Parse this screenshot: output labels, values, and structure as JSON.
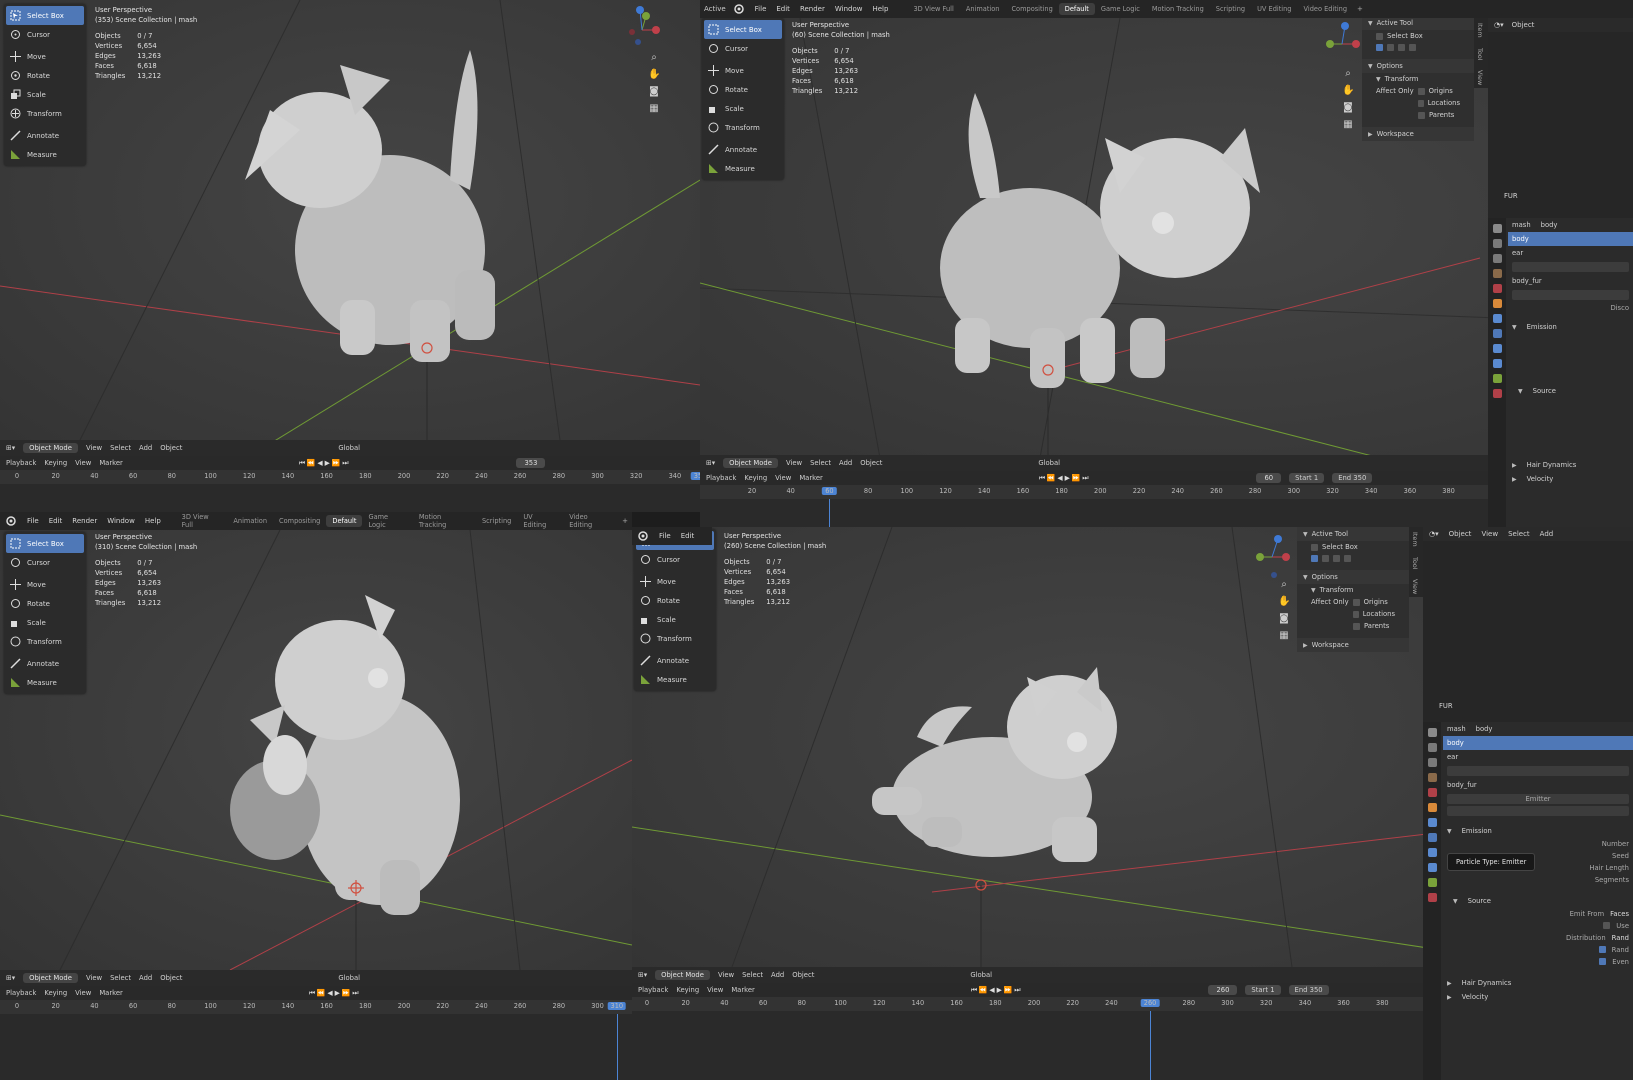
{
  "stats": {
    "perspective": "User Perspective",
    "objects_label": "Objects",
    "objects": "0 / 7",
    "vertices_label": "Vertices",
    "vertices": "6,654",
    "edges_label": "Edges",
    "edges": "13,263",
    "faces_label": "Faces",
    "faces": "6,618",
    "triangles_label": "Triangles",
    "triangles": "13,212"
  },
  "panes": [
    {
      "collection": "(353) Scene Collection | mash",
      "frame": "353"
    },
    {
      "collection": "(60) Scene Collection | mash",
      "frame": "60"
    },
    {
      "collection": "(310) Scene Collection | mash",
      "frame": "310"
    },
    {
      "collection": "(260) Scene Collection | mash",
      "frame": "260"
    }
  ],
  "tools": [
    "Select Box",
    "Cursor",
    "Move",
    "Rotate",
    "Scale",
    "Transform",
    "Annotate",
    "Measure"
  ],
  "topmenu": [
    "File",
    "Edit",
    "Render",
    "Window",
    "Help"
  ],
  "workspaces": [
    "3D View Full",
    "Animation",
    "Compositing",
    "Default",
    "Game Logic",
    "Motion Tracking",
    "Scripting",
    "UV Editing",
    "Video Editing"
  ],
  "header": {
    "mode": "Object Mode",
    "view": "View",
    "select": "Select",
    "add": "Add",
    "object": "Object",
    "orientation": "Global"
  },
  "timeline": {
    "playback": "Playback",
    "keying": "Keying",
    "view": "View",
    "marker": "Marker",
    "start_label": "Start",
    "start": "1",
    "end_label": "End",
    "end": "350",
    "ruler_a": [
      "0",
      "20",
      "40",
      "60",
      "80",
      "100",
      "120",
      "140",
      "160",
      "180",
      "200",
      "220",
      "240",
      "260",
      "280",
      "300",
      "320",
      "340"
    ],
    "ruler_b": [
      "20",
      "40",
      "60",
      "80",
      "100",
      "120",
      "140",
      "160",
      "180",
      "200",
      "220",
      "240",
      "260",
      "280",
      "300",
      "320",
      "340",
      "360",
      "380"
    ],
    "ruler_c": [
      "0",
      "20",
      "40",
      "60",
      "80",
      "100",
      "120",
      "140",
      "160",
      "180",
      "200",
      "220",
      "240",
      "260",
      "280",
      "300"
    ],
    "ruler_d": [
      "0",
      "20",
      "40",
      "60",
      "80",
      "100",
      "120",
      "140",
      "160",
      "180",
      "200",
      "220",
      "240",
      "260",
      "280",
      "300",
      "320",
      "340",
      "360",
      "380"
    ]
  },
  "right_panel": {
    "active_tool": "Active Tool",
    "select_box": "Select Box",
    "options": "Options",
    "transform": "Transform",
    "affect_only": "Affect Only",
    "origins": "Origins",
    "locations": "Locations",
    "parents": "Parents",
    "workspace": "Workspace",
    "tabs": [
      "Item",
      "Tool",
      "View"
    ]
  },
  "properties": {
    "object_label": "Object",
    "fur": "FUR",
    "mash": "mash",
    "body": "body",
    "ear": "ear",
    "body_fur": "body_fur",
    "emitter": "Emitter",
    "emission": "Emission",
    "source": "Source",
    "number": "Number",
    "seed": "Seed",
    "hair_length": "Hair Length",
    "segments": "Segments",
    "emit_from": "Emit From",
    "faces": "Faces",
    "distribution": "Distribution",
    "use": "Use",
    "random": "Rand",
    "even": "Even",
    "hair_dynamics": "Hair Dynamics",
    "velocity": "Velocity",
    "tooltip": "Particle Type:  Emitter",
    "disco": "Disco"
  },
  "overlapping": {
    "active": "Active",
    "option": "Option",
    "tran": "Tran",
    "affect": "Affect C",
    "works": "Works",
    "se": "Se"
  },
  "colors": {
    "accent": "#4f78b7",
    "x_axis": "#c0404a",
    "y_axis": "#7aa23a",
    "z_axis": "#3f7ad6",
    "playhead": "#4c84d4"
  }
}
